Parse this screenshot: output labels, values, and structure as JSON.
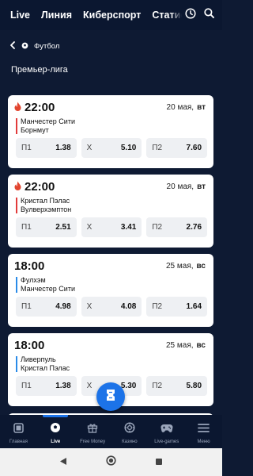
{
  "topnav": {
    "tabs": [
      "Live",
      "Линия",
      "Киберспорт",
      "Статистика"
    ]
  },
  "breadcrumb": {
    "label": "Футбол"
  },
  "league": {
    "title": "Премьер-лига"
  },
  "matches": [
    {
      "time": "22:00",
      "date": "20 мая,",
      "weekday": "вт",
      "team1": "Манчестер Сити",
      "team2": "Борнмут",
      "bar_color": "#e23b3b",
      "hot": true,
      "odds": [
        {
          "label": "П1",
          "value": "1.38"
        },
        {
          "label": "Х",
          "value": "5.10"
        },
        {
          "label": "П2",
          "value": "7.60"
        }
      ]
    },
    {
      "time": "22:00",
      "date": "20 мая,",
      "weekday": "вт",
      "team1": "Кристал Пэлас",
      "team2": "Вулверхэмптон",
      "bar_color": "#e23b3b",
      "hot": true,
      "odds": [
        {
          "label": "П1",
          "value": "2.51"
        },
        {
          "label": "Х",
          "value": "3.41"
        },
        {
          "label": "П2",
          "value": "2.76"
        }
      ]
    },
    {
      "time": "18:00",
      "date": "25 мая,",
      "weekday": "вс",
      "team1": "Фулхэм",
      "team2": "Манчестер Сити",
      "bar_color": "#2a8be8",
      "hot": false,
      "odds": [
        {
          "label": "П1",
          "value": "4.98"
        },
        {
          "label": "Х",
          "value": "4.08"
        },
        {
          "label": "П2",
          "value": "1.64"
        }
      ]
    },
    {
      "time": "18:00",
      "date": "25 мая,",
      "weekday": "вс",
      "team1": "Ливерпуль",
      "team2": "Кристал Пэлас",
      "bar_color": "#2a8be8",
      "hot": false,
      "odds": [
        {
          "label": "П1",
          "value": "1.38"
        },
        {
          "label": "Х",
          "value": "5.30"
        },
        {
          "label": "П2",
          "value": "5.80"
        }
      ]
    }
  ],
  "bottomnav": {
    "items": [
      "Главная",
      "Live",
      "Free Money",
      "Казино",
      "Live-games",
      "Меню"
    ],
    "active": "Live"
  },
  "colors": {
    "background": "#0e1a33",
    "accent": "#1c73e8",
    "hot": "#e23b3b",
    "upcoming": "#2a8be8"
  }
}
